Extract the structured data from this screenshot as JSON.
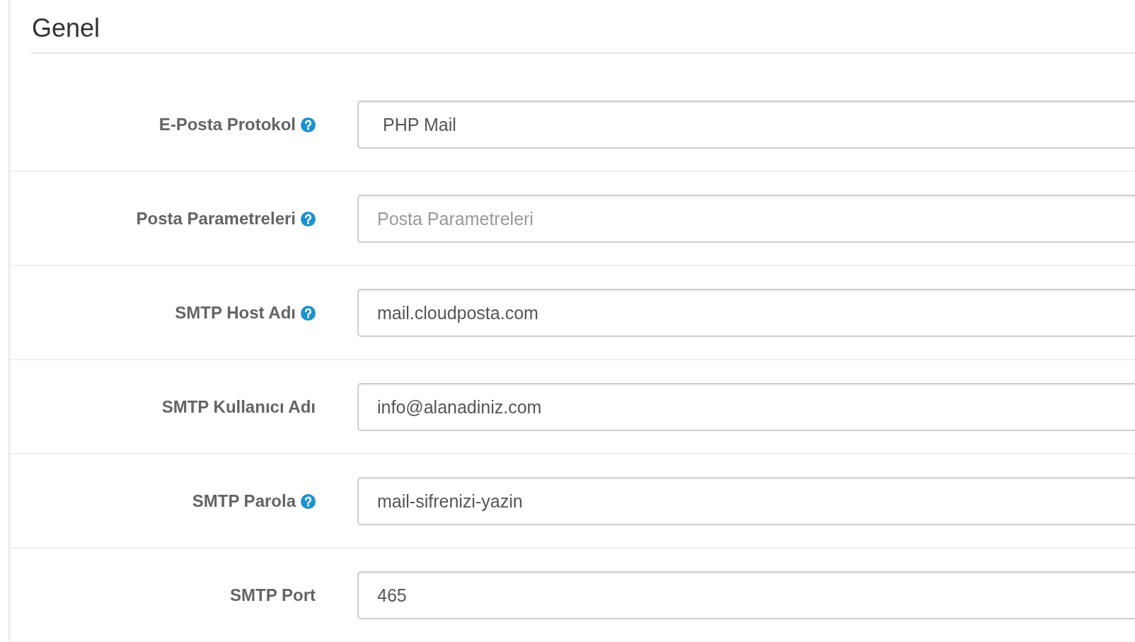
{
  "section": {
    "title": "Genel"
  },
  "fields": [
    {
      "label": "E-Posta Protokol",
      "help": true,
      "kind": "select",
      "value": "PHP Mail"
    },
    {
      "label": "Posta Parametreleri",
      "help": true,
      "kind": "text",
      "placeholder": "Posta Parametreleri"
    },
    {
      "label": "SMTP Host Adı",
      "help": true,
      "kind": "text",
      "value": "mail.cloudposta.com"
    },
    {
      "label": "SMTP Kullanıcı Adı",
      "help": false,
      "kind": "text",
      "value": "info@alanadiniz.com"
    },
    {
      "label": "SMTP Parola",
      "help": true,
      "kind": "text",
      "value": "mail-sifrenizi-yazin"
    },
    {
      "label": "SMTP Port",
      "help": false,
      "kind": "text",
      "value": "465"
    }
  ]
}
